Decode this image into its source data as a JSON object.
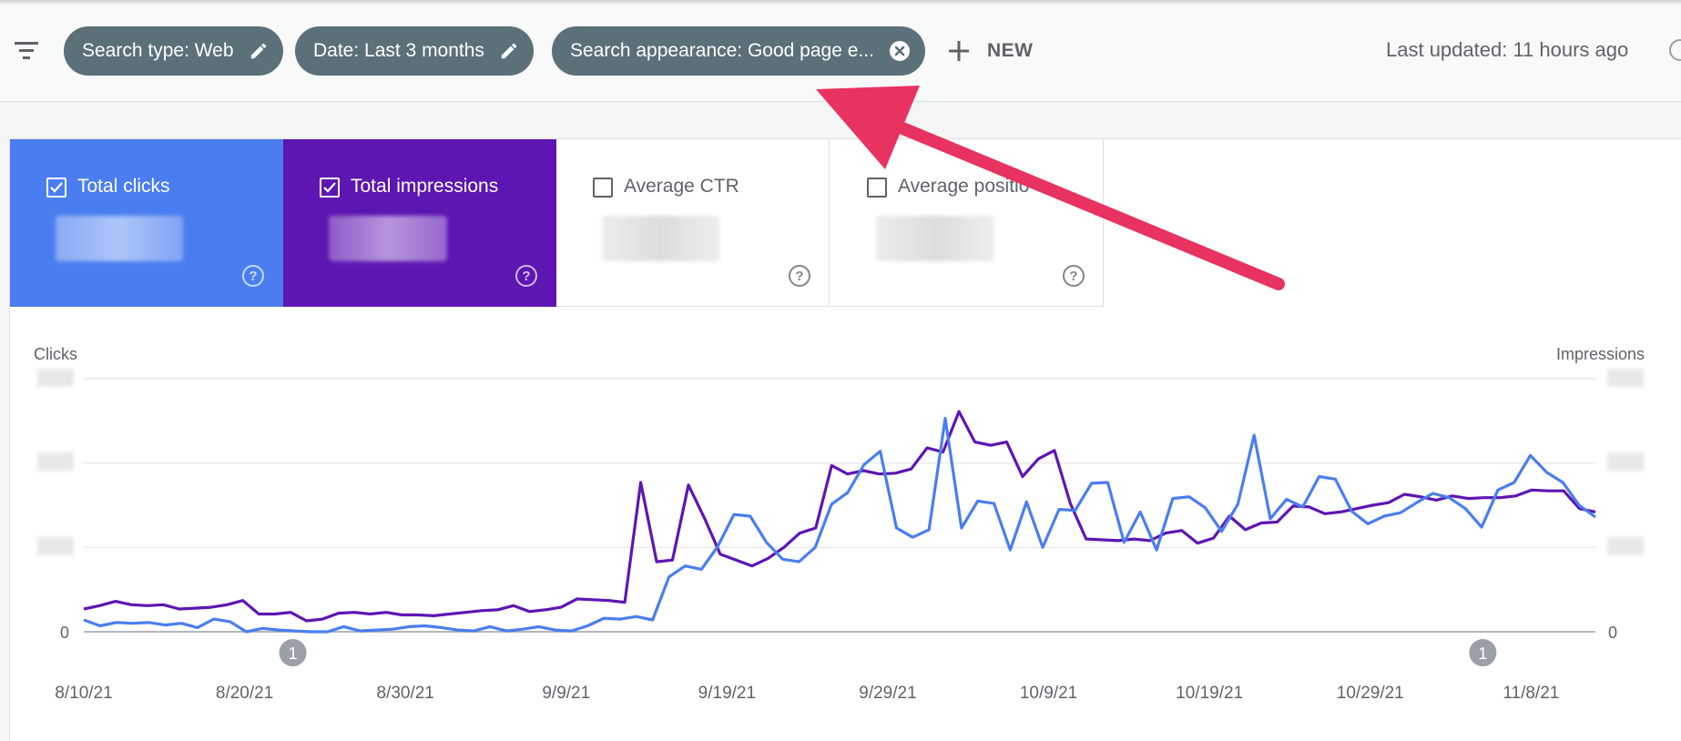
{
  "filters": {
    "chips": [
      {
        "label": "Search type: Web",
        "icon": "edit-icon"
      },
      {
        "label": "Date: Last 3 months",
        "icon": "edit-icon"
      },
      {
        "label": "Search appearance: Good page e...",
        "icon": "remove-icon"
      }
    ],
    "new_label": "NEW",
    "last_updated": "Last updated: 11 hours ago"
  },
  "metrics": [
    {
      "label": "Total clicks",
      "checked": true,
      "color": "#4a7ef0"
    },
    {
      "label": "Total impressions",
      "checked": true,
      "color": "#5e16b2"
    },
    {
      "label": "Average CTR",
      "checked": false
    },
    {
      "label": "Average positio",
      "checked": false
    }
  ],
  "annotation_arrow": {
    "color": "#e8325f"
  },
  "chart_data": {
    "type": "line",
    "left_axis_label": "Clicks",
    "right_axis_label": "Impressions",
    "zero_label": "0",
    "x_tick_labels": [
      "8/10/21",
      "8/20/21",
      "8/30/21",
      "9/9/21",
      "9/19/21",
      "9/29/21",
      "10/9/21",
      "10/19/21",
      "10/29/21",
      "11/8/21"
    ],
    "event_markers": [
      {
        "date": "8/23/21",
        "label": "1"
      },
      {
        "date": "11/5/21",
        "label": "1"
      }
    ],
    "x_range": [
      "8/10/21",
      "11/12/21"
    ],
    "ylim": [
      0,
      3
    ],
    "series": [
      {
        "color": "#5e16b2",
        "values": [
          0.27,
          0.31,
          0.36,
          0.32,
          0.31,
          0.32,
          0.27,
          0.28,
          0.29,
          0.32,
          0.37,
          0.21,
          0.21,
          0.23,
          0.13,
          0.15,
          0.22,
          0.23,
          0.21,
          0.23,
          0.2,
          0.2,
          0.19,
          0.21,
          0.23,
          0.25,
          0.26,
          0.31,
          0.24,
          0.26,
          0.29,
          0.39,
          0.38,
          0.37,
          0.35,
          1.77,
          0.83,
          0.85,
          1.74,
          1.35,
          0.92,
          0.85,
          0.78,
          0.87,
          1.0,
          1.17,
          1.23,
          1.97,
          1.87,
          1.91,
          1.87,
          1.88,
          1.93,
          2.18,
          2.13,
          2.61,
          2.25,
          2.21,
          2.25,
          1.84,
          2.05,
          2.15,
          1.52,
          1.1,
          1.09,
          1.08,
          1.1,
          1.08,
          1.17,
          1.2,
          1.05,
          1.11,
          1.37,
          1.21,
          1.29,
          1.3,
          1.49,
          1.48,
          1.4,
          1.42,
          1.46,
          1.5,
          1.53,
          1.63,
          1.6,
          1.56,
          1.61,
          1.58,
          1.59,
          1.59,
          1.61,
          1.68,
          1.67,
          1.67,
          1.46,
          1.42
        ]
      },
      {
        "color": "#4a7ef0",
        "values": [
          0.14,
          0.07,
          0.11,
          0.1,
          0.11,
          0.08,
          0.1,
          0.05,
          0.15,
          0.12,
          0.0,
          0.04,
          0.02,
          0.01,
          0.0,
          0.0,
          0.06,
          0.01,
          0.02,
          0.03,
          0.06,
          0.07,
          0.05,
          0.02,
          0.01,
          0.06,
          0.01,
          0.03,
          0.06,
          0.02,
          0.01,
          0.07,
          0.16,
          0.15,
          0.18,
          0.14,
          0.65,
          0.78,
          0.74,
          1.01,
          1.39,
          1.37,
          1.06,
          0.86,
          0.83,
          1.0,
          1.51,
          1.65,
          1.98,
          2.14,
          1.23,
          1.12,
          1.21,
          2.53,
          1.23,
          1.55,
          1.52,
          0.97,
          1.54,
          1.0,
          1.45,
          1.44,
          1.76,
          1.77,
          1.06,
          1.42,
          0.97,
          1.58,
          1.6,
          1.47,
          1.19,
          1.51,
          2.33,
          1.34,
          1.57,
          1.48,
          1.84,
          1.81,
          1.43,
          1.28,
          1.37,
          1.41,
          1.53,
          1.64,
          1.59,
          1.46,
          1.24,
          1.68,
          1.77,
          2.09,
          1.89,
          1.77,
          1.5,
          1.36
        ]
      }
    ]
  }
}
